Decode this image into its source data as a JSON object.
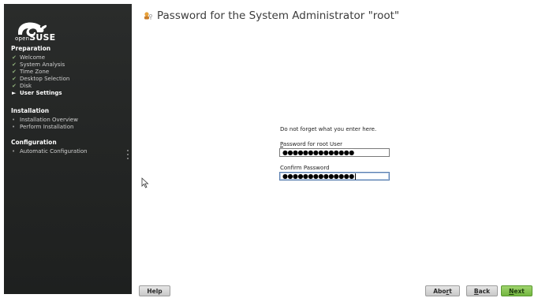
{
  "sidebar": {
    "brand": {
      "small": "open",
      "big": "SUSE"
    },
    "sections": [
      {
        "title": "Preparation",
        "steps": [
          {
            "label": "Welcome",
            "state": "done"
          },
          {
            "label": "System Analysis",
            "state": "done"
          },
          {
            "label": "Time Zone",
            "state": "done"
          },
          {
            "label": "Desktop Selection",
            "state": "done"
          },
          {
            "label": "Disk",
            "state": "done"
          },
          {
            "label": "User Settings",
            "state": "current"
          }
        ]
      },
      {
        "title": "Installation",
        "steps": [
          {
            "label": "Installation Overview",
            "state": "todo"
          },
          {
            "label": "Perform Installation",
            "state": "todo"
          }
        ]
      },
      {
        "title": "Configuration",
        "steps": [
          {
            "label": "Automatic Configuration",
            "state": "todo"
          }
        ]
      }
    ]
  },
  "main": {
    "title": "Password for the System Administrator \"root\"",
    "hint": "Do not forget what you enter here.",
    "password_label_mnemonic": "P",
    "password_label_rest": "assword for root User",
    "password_value": "●●●●●●●●●●●●●●",
    "confirm_label": "Confirm Password",
    "confirm_value": "●●●●●●●●●●●●●●"
  },
  "buttons": {
    "help": "Help",
    "abort_pre": "Abo",
    "abort_ul": "r",
    "abort_post": "t",
    "back_ul": "B",
    "back_post": "ack",
    "next_ul": "N",
    "next_post": "ext"
  },
  "colors": {
    "sidebar_bg": "#232524",
    "done_check": "#8fb07a",
    "next_button": "#73b740"
  },
  "icons": {
    "logo": "opensuse-chameleon-icon",
    "title": "user-key-icon",
    "done": "checkmark-icon",
    "current": "arrow-right-icon",
    "todo": "bullet-icon",
    "pointer": "mouse-pointer-icon"
  }
}
